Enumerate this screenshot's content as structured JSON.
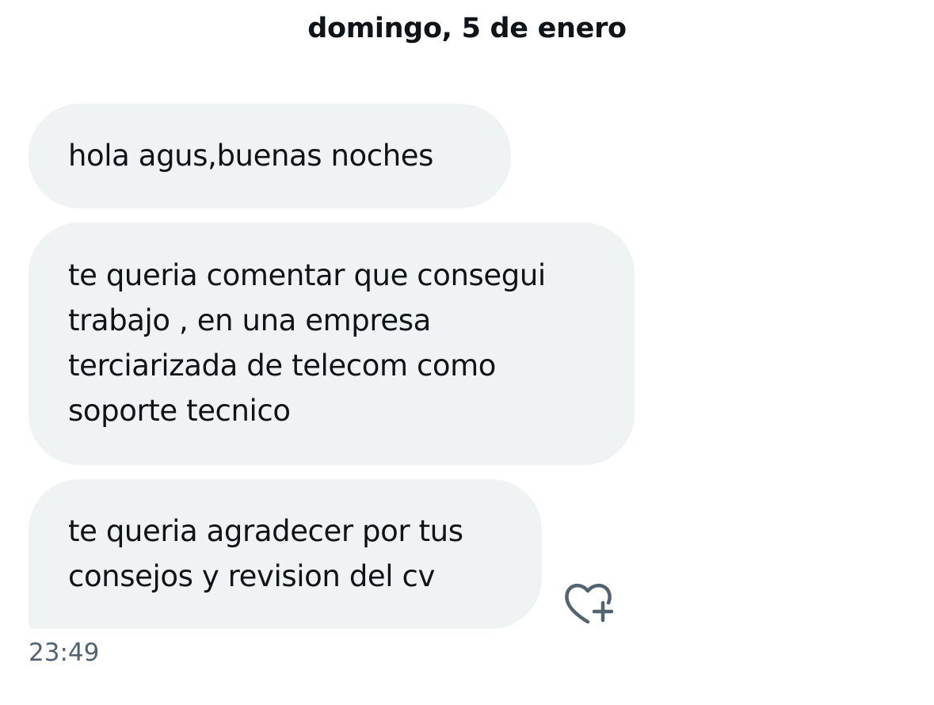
{
  "conversation": {
    "date_header": "domingo, 5 de enero",
    "messages": [
      {
        "lines": [
          "hola agus,buenas noches"
        ]
      },
      {
        "lines": [
          "te queria comentar que consegui",
          "trabajo , en una empresa",
          "terciarizada de telecom como",
          "soporte tecnico"
        ]
      },
      {
        "lines": [
          "te queria agradecer por tus",
          "consejos y revision del cv"
        ]
      }
    ],
    "timestamp": "23:49",
    "like_icon": "heart-plus-icon"
  },
  "colors": {
    "bubble_background": "#eff3f4",
    "text": "#0f1419",
    "secondary_text": "#536471"
  }
}
